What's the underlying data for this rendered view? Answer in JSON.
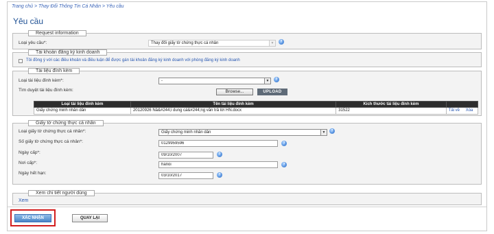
{
  "breadcrumb": "Trang chủ > Thay Đổi Thông Tin Cá Nhân > Yêu cầu",
  "page_title": "Yêu cầu",
  "request_info": {
    "legend": "Request information",
    "request_type_label": "Loại yêu cầu*:",
    "request_type_value": "Thay đổi giấy tờ chứng thực cá nhân"
  },
  "business_account": {
    "legend": "Tài khoản đăng ký kinh doanh",
    "agree_text": "Tôi đồng ý với các điều khoản và điều luận để được gán tài khoản đăng ký kinh doanh với phòng đăng ký kinh doanh"
  },
  "attachments": {
    "legend": "Tài liệu đính kèm",
    "type_label": "Loại tài liệu đính kèm*:",
    "type_value": "-",
    "browse_label": "Tìm duyệt tài liệu đính kèm:",
    "browse_button": "Browse...",
    "upload_button": "UPLOAD",
    "columns": [
      "Loại tài liệu đính kèm",
      "Tên tài liệu đính kèm",
      "Kích thước tài liệu đính kèm",
      ""
    ],
    "rows": [
      {
        "type": "Giấy chứng minh nhân dân",
        "name": "20120926 Nâ&#244;i dung cá&#244;ng văn trả lời HN.docx",
        "size": "31522",
        "view": "Tải về",
        "delete": "Xóa"
      }
    ]
  },
  "id_document": {
    "legend": "Giấy tờ chứng thực cá nhân",
    "type_label": "Loại giấy tờ chứng thực cá nhân*:",
    "type_value": "Giấy chứng minh nhân dân",
    "number_label": "Số giấy tờ chứng thực cá nhân*:",
    "number_value": "0129959596",
    "issue_date_label": "Ngày cấp*:",
    "issue_date_value": "09/10/2007",
    "issue_place_label": "Nơi cấp*:",
    "issue_place_value": "hanoi",
    "expiry_label": "Ngày hết hạn:",
    "expiry_value": "03/10/2017"
  },
  "user_details": {
    "legend": "Xem chi tiết người dùng",
    "view_link": "Xem"
  },
  "actions": {
    "confirm": "XÁC NHẬN",
    "back": "QUAY LẠI"
  },
  "help_glyph": "?",
  "dropdown_glyph": "▼"
}
